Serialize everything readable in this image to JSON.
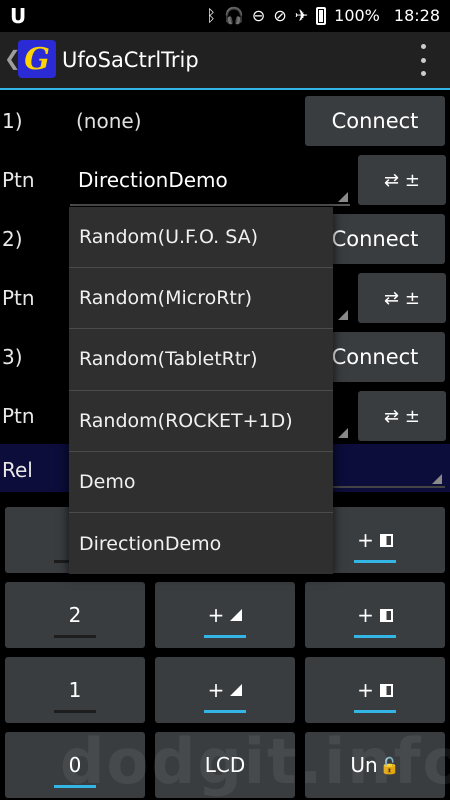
{
  "status_bar": {
    "left_glyph": "U",
    "battery": "100%",
    "time": "18:28"
  },
  "action_bar": {
    "logo_letter": "G",
    "title": "UfoSaCtrlTrip"
  },
  "rows": [
    {
      "index": "1)",
      "device": "(none)",
      "connect_label": "Connect",
      "ptn_label": "Ptn",
      "ptn_value": "DirectionDemo",
      "swap_label": "⇄ ±"
    },
    {
      "index": "2)",
      "connect_label": "Connect",
      "ptn_label": "Ptn",
      "swap_label": "⇄ ±"
    },
    {
      "index": "3)",
      "connect_label": "Connect",
      "ptn_label": "Ptn",
      "swap_label": "⇄ ±"
    }
  ],
  "rel_label": "Rel",
  "grid": {
    "row1": {
      "c3": "+"
    },
    "row2": {
      "c1": "2",
      "c2": "+",
      "c3": "+"
    },
    "row3": {
      "c1": "1",
      "c2": "+",
      "c3": "+"
    },
    "row4": {
      "c1": "0",
      "c2": "LCD",
      "c3": "Un"
    }
  },
  "dropdown": {
    "items": [
      "Random(U.F.O. SA)",
      "Random(MicroRtr)",
      "Random(TabletRtr)",
      "Random(ROCKET+1D)",
      "Demo",
      "DirectionDemo"
    ]
  },
  "watermark": "dodgit.info",
  "colors": {
    "accent": "#33b5e5",
    "button": "#3a3d40",
    "rel_bar": "#0c0d3a",
    "logo_bg": "#2b2bd6",
    "logo_fg": "#ffd400"
  }
}
